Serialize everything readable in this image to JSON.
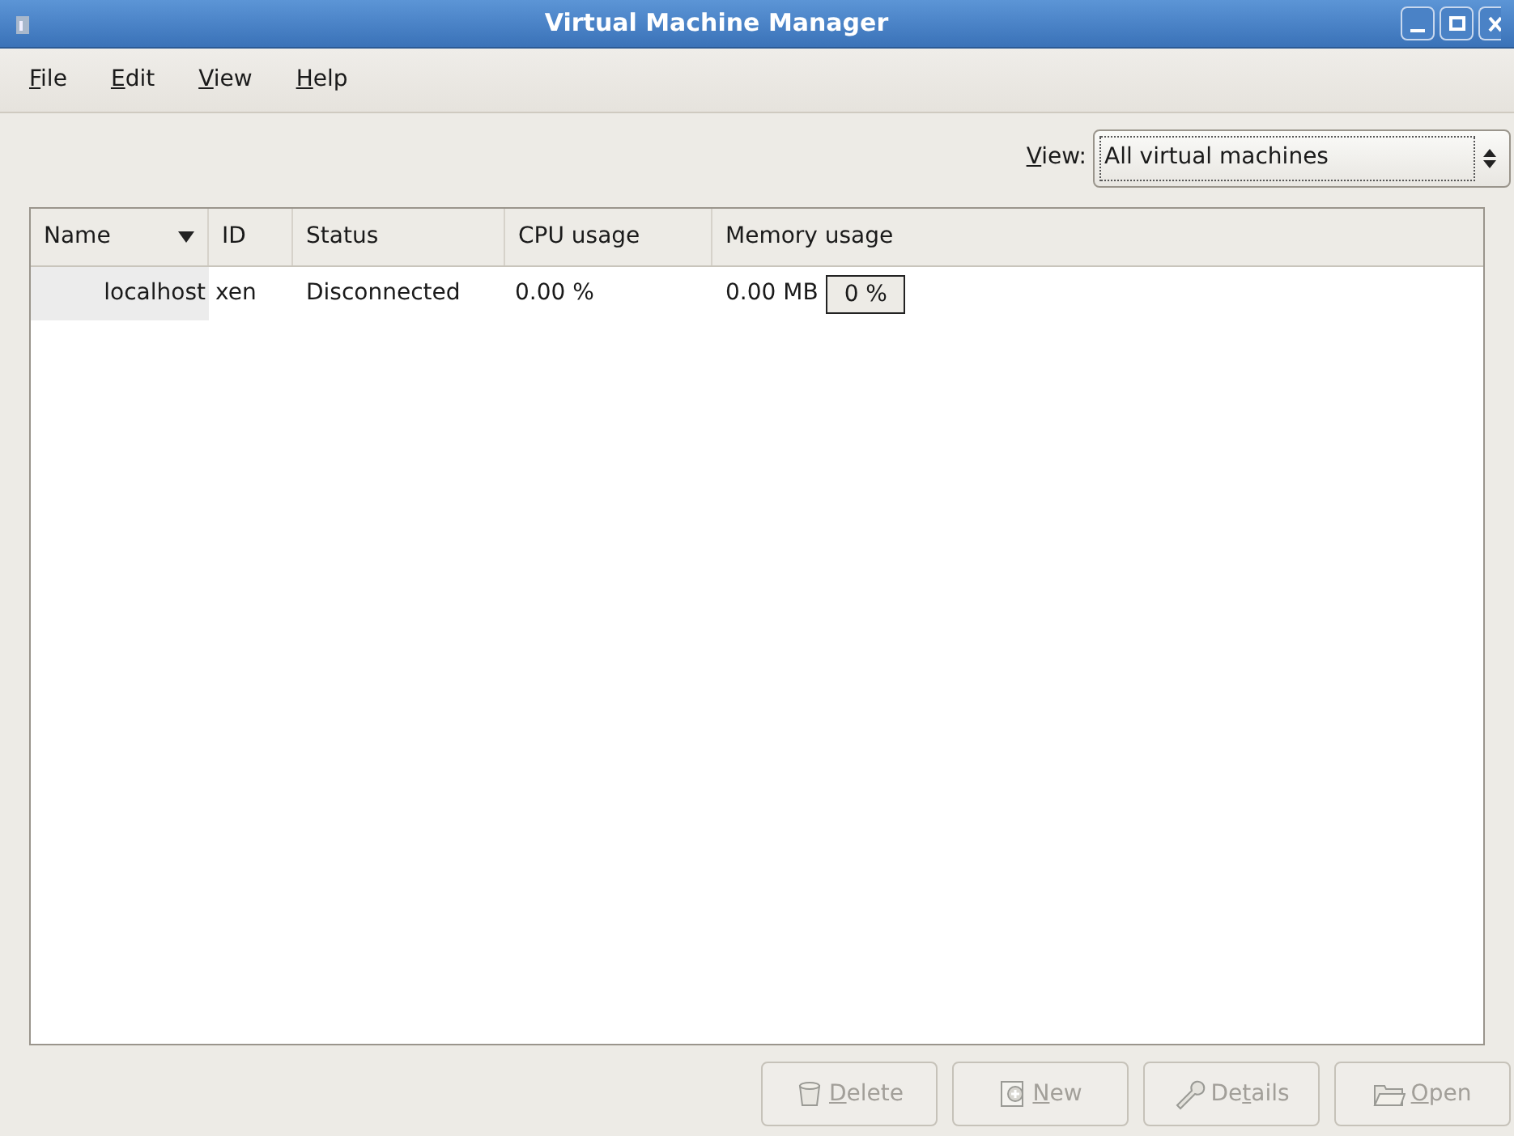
{
  "window": {
    "title": "Virtual Machine Manager"
  },
  "menu": [
    {
      "key": "F",
      "post": "ile"
    },
    {
      "key": "E",
      "post": "dit"
    },
    {
      "key": "V",
      "post": "iew"
    },
    {
      "key": "H",
      "post": "elp"
    }
  ],
  "view_filter": {
    "label": {
      "key": "V",
      "post": "iew:"
    },
    "value": "All virtual machines"
  },
  "table": {
    "columns": [
      {
        "label": "Name",
        "sorted": true
      },
      {
        "label": "ID",
        "sorted": false
      },
      {
        "label": "Status",
        "sorted": false
      },
      {
        "label": "CPU usage",
        "sorted": false
      },
      {
        "label": "Memory usage",
        "sorted": false
      }
    ],
    "rows": [
      {
        "name": "localhost",
        "id": "xen",
        "status": "Disconnected",
        "cpu": "0.00 %",
        "memory": "0.00 MB",
        "memory_percent": "0 %"
      }
    ]
  },
  "buttons": [
    {
      "kind": "delete",
      "key": "D",
      "post": "elete",
      "disabled": true
    },
    {
      "kind": "new",
      "key": "N",
      "post": "ew",
      "disabled": true
    },
    {
      "kind": "details",
      "pre": "De",
      "key": "t",
      "post": "ails",
      "disabled": true
    },
    {
      "kind": "open",
      "key": "O",
      "post": "pen",
      "disabled": true
    }
  ]
}
